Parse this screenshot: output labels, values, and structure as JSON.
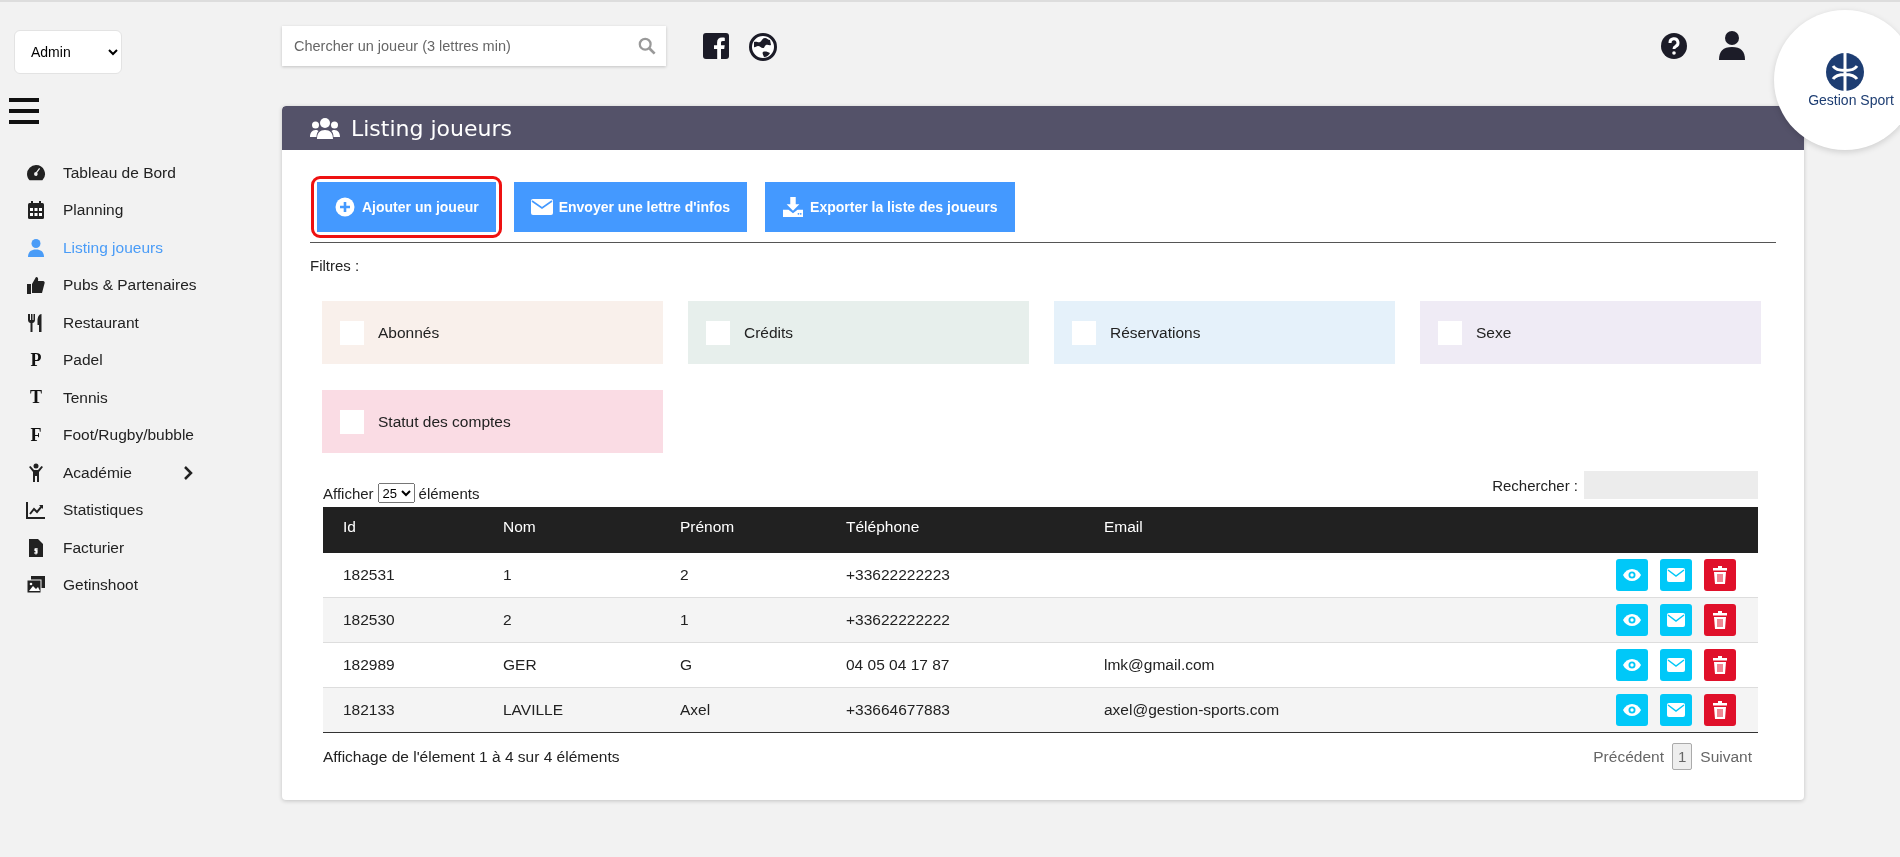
{
  "role_select": {
    "value": "Admin"
  },
  "sidebar": {
    "items": [
      {
        "label": "Tableau de Bord",
        "selected": false,
        "submenu": false
      },
      {
        "label": "Planning",
        "selected": false,
        "submenu": false
      },
      {
        "label": "Listing joueurs",
        "selected": true,
        "submenu": false
      },
      {
        "label": "Pubs & Partenaires",
        "selected": false,
        "submenu": false
      },
      {
        "label": "Restaurant",
        "selected": false,
        "submenu": false
      },
      {
        "label": "Padel",
        "letter": "P",
        "selected": false,
        "submenu": false
      },
      {
        "label": "Tennis",
        "letter": "T",
        "selected": false,
        "submenu": false
      },
      {
        "label": "Foot/Rugby/bubble",
        "letter": "F",
        "selected": false,
        "submenu": false
      },
      {
        "label": "Académie",
        "selected": false,
        "submenu": true
      },
      {
        "label": "Statistiques",
        "selected": false,
        "submenu": false
      },
      {
        "label": "Facturier",
        "selected": false,
        "submenu": false
      },
      {
        "label": "Getinshoot",
        "selected": false,
        "submenu": false
      }
    ]
  },
  "search": {
    "placeholder": "Chercher un joueur (3 lettres min)"
  },
  "logo": {
    "text": "Gestion Sport"
  },
  "panel": {
    "title": "Listing joueurs",
    "actions": [
      {
        "label": "Ajouter un joueur",
        "highlighted": true
      },
      {
        "label": "Envoyer une lettre d'infos",
        "highlighted": false
      },
      {
        "label": "Exporter la liste des joueurs",
        "highlighted": false
      }
    ],
    "filters_label": "Filtres :",
    "filters": [
      {
        "label": "Abonnés",
        "checked": false,
        "color": "#f9f0eb"
      },
      {
        "label": "Crédits",
        "checked": false,
        "color": "#e7efec"
      },
      {
        "label": "Réservations",
        "checked": false,
        "color": "#e5f1fa"
      },
      {
        "label": "Sexe",
        "checked": false,
        "color": "#efebf5"
      },
      {
        "label": "Statut des comptes",
        "checked": false,
        "color": "#fadce4"
      }
    ]
  },
  "table": {
    "length_before": "Afficher",
    "length_value": "25",
    "length_after": "éléments",
    "search_label": "Rechercher :",
    "columns": [
      "Id",
      "Nom",
      "Prénom",
      "Téléphone",
      "Email"
    ],
    "rows": [
      [
        "182531",
        "1",
        "2",
        "+33622222223",
        ""
      ],
      [
        "182530",
        "2",
        "1",
        "+33622222222",
        ""
      ],
      [
        "182989",
        "GER",
        "G",
        "04 05 04 17 87",
        "lmk@gmail.com"
      ],
      [
        "182133",
        "LAVILLE",
        "Axel",
        "+33664677883",
        "axel@gestion-sports.com"
      ]
    ],
    "info": "Affichage de l'élement 1 à 4 sur 4 éléments",
    "pagination": {
      "previous": "Précédent",
      "pages": [
        {
          "label": "1",
          "selected": true
        }
      ],
      "next": "Suivant"
    }
  }
}
